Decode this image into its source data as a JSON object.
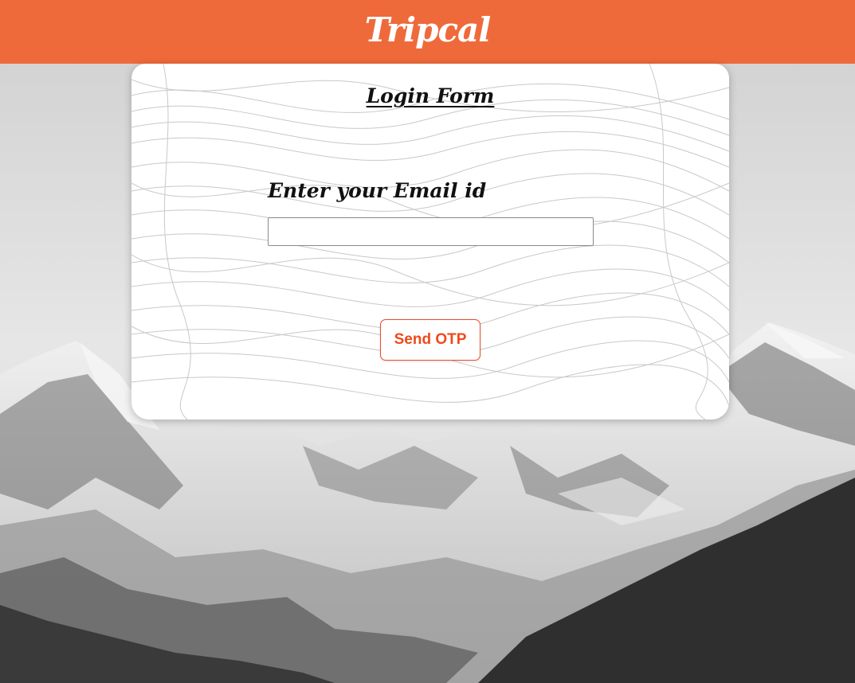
{
  "header": {
    "brand": "Tripcal",
    "background_color": "#ef6a3a"
  },
  "login_form": {
    "title": "Login Form",
    "email_label": "Enter your Email id",
    "email_value": "",
    "email_placeholder": "",
    "submit_label": "Send OTP",
    "accent_color": "#ef4a1a"
  }
}
